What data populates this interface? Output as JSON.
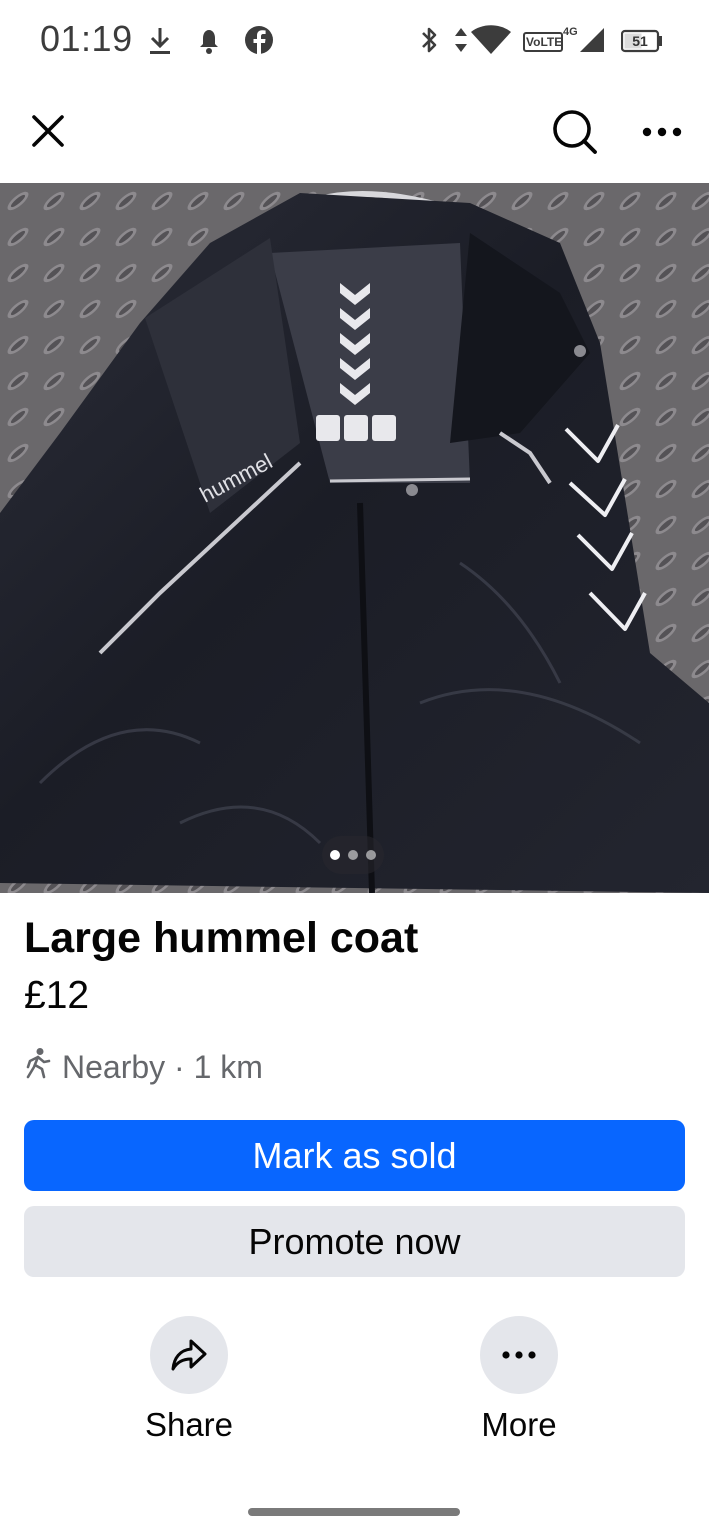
{
  "status_bar": {
    "time": "01:19",
    "network_label": "VoLTE",
    "network_type": "4G",
    "battery_level": "51",
    "icons": [
      "download-icon",
      "notification-icon",
      "facebook-icon",
      "bluetooth-icon",
      "data-arrows-icon",
      "wifi-icon",
      "volte-icon",
      "signal-icon",
      "battery-icon"
    ]
  },
  "top_bar": {
    "icons": [
      "close-icon",
      "search-icon",
      "more-icon"
    ]
  },
  "photo": {
    "description_icon": "jacket-photo",
    "page_count": 3,
    "current_page": 1,
    "brand_print": "hummel"
  },
  "listing": {
    "title": "Large hummel coat",
    "price": "£12",
    "location": "Nearby · 1 km"
  },
  "buttons": {
    "mark_sold": "Mark as sold",
    "promote": "Promote now"
  },
  "actions": {
    "share": "Share",
    "more": "More"
  },
  "colors": {
    "primary": "#0866ff",
    "secondary_bg": "#e4e6eb",
    "text": "#050505",
    "muted": "#65676b"
  }
}
